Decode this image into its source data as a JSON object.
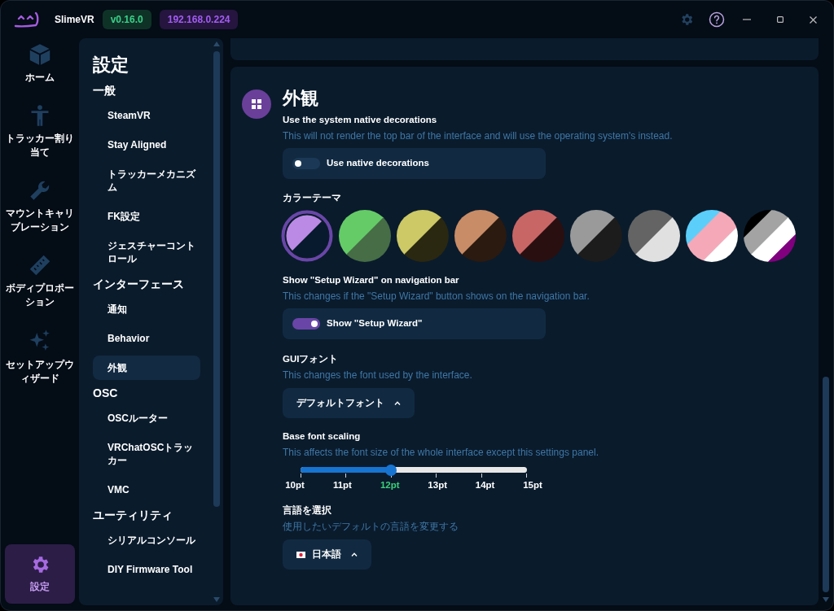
{
  "app": {
    "name": "SlimeVR",
    "version": "v0.16.0",
    "ip": "192.168.0.224"
  },
  "nav": [
    {
      "label": "ホーム",
      "selected": false
    },
    {
      "label": "トラッカー割り当て",
      "selected": false
    },
    {
      "label": "マウントキャリブレーション",
      "selected": false
    },
    {
      "label": "ボディプロポーション",
      "selected": false
    },
    {
      "label": "セットアップウィザード",
      "selected": false
    },
    {
      "label": "設定",
      "selected": true
    }
  ],
  "settings_sidebar": {
    "title": "設定",
    "groups": [
      {
        "title": "一般",
        "items": [
          {
            "label": "SteamVR",
            "selected": false
          },
          {
            "label": "Stay Aligned",
            "selected": false
          },
          {
            "label": "トラッカーメカニズム",
            "selected": false
          },
          {
            "label": "FK設定",
            "selected": false
          },
          {
            "label": "ジェスチャーコントロール",
            "selected": false
          }
        ]
      },
      {
        "title": "インターフェース",
        "items": [
          {
            "label": "通知",
            "selected": false
          },
          {
            "label": "Behavior",
            "selected": false
          },
          {
            "label": "外観",
            "selected": true
          }
        ]
      },
      {
        "title": "OSC",
        "items": [
          {
            "label": "OSCルーター",
            "selected": false
          },
          {
            "label": "VRChatOSCトラッカー",
            "selected": false
          },
          {
            "label": "VMC",
            "selected": false
          }
        ]
      },
      {
        "title": "ユーティリティ",
        "items": [
          {
            "label": "シリアルコンソール",
            "selected": false
          },
          {
            "label": "DIY Firmware Tool",
            "selected": false
          }
        ]
      }
    ]
  },
  "section": {
    "title": "外観",
    "native_decorations": {
      "title": "Use the system native decorations",
      "description": "This will not render the top bar of the interface and will use the operating system's instead.",
      "toggle_label": "Use native decorations",
      "on": false
    },
    "color_theme": {
      "title": "カラーテーマ",
      "themes": [
        {
          "stripes": [
            {
              "color": "#bb8ae5"
            },
            {
              "color": "#081a2d"
            }
          ],
          "selected": true
        },
        {
          "stripes": [
            {
              "color": "#65cb67"
            },
            {
              "color": "#466d46"
            }
          ],
          "selected": false
        },
        {
          "stripes": [
            {
              "color": "#ccc966"
            },
            {
              "color": "#2a2810"
            }
          ],
          "selected": false
        },
        {
          "stripes": [
            {
              "color": "#c88c66"
            },
            {
              "color": "#2a1a10"
            }
          ],
          "selected": false
        },
        {
          "stripes": [
            {
              "color": "#c86666"
            },
            {
              "color": "#2a0f10"
            }
          ],
          "selected": false
        },
        {
          "stripes": [
            {
              "color": "#9a9a9a"
            },
            {
              "color": "#1c1c1c"
            }
          ],
          "selected": false
        },
        {
          "stripes": [
            {
              "color": "#646464"
            },
            {
              "color": "#e0e0e0"
            }
          ],
          "selected": false
        },
        {
          "stripes": [
            {
              "color": "#5bcefa"
            },
            {
              "color": "#f5a9b8"
            },
            {
              "color": "#ffffff"
            }
          ],
          "selected": false
        },
        {
          "stripes": [
            {
              "color": "#000000"
            },
            {
              "color": "#a3a3a3"
            },
            {
              "color": "#ffffff"
            },
            {
              "color": "#800080"
            }
          ],
          "selected": false
        }
      ]
    },
    "setup_wizard": {
      "title": "Show \"Setup Wizard\" on navigation bar",
      "description": "This changes if the \"Setup Wizard\" button shows on the navigation bar.",
      "toggle_label": "Show \"Setup Wizard\"",
      "on": true
    },
    "gui_font": {
      "title": "GUIフォント",
      "description": "This changes the font used by the interface.",
      "value": "デフォルトフォント",
      "expanded": true
    },
    "font_scaling": {
      "title": "Base font scaling",
      "description": "This affects the font size of the whole interface except this settings panel.",
      "level": 0.4,
      "ticks": [
        {
          "label": "10pt",
          "selected": false
        },
        {
          "label": "11pt",
          "selected": false
        },
        {
          "label": "12pt",
          "selected": true
        },
        {
          "label": "13pt",
          "selected": false
        },
        {
          "label": "14pt",
          "selected": false
        },
        {
          "label": "15pt",
          "selected": false
        }
      ]
    },
    "language": {
      "title": "言語を選択",
      "description": "使用したいデフォルトの言語を変更する",
      "value": "日本語",
      "expanded": true
    }
  }
}
